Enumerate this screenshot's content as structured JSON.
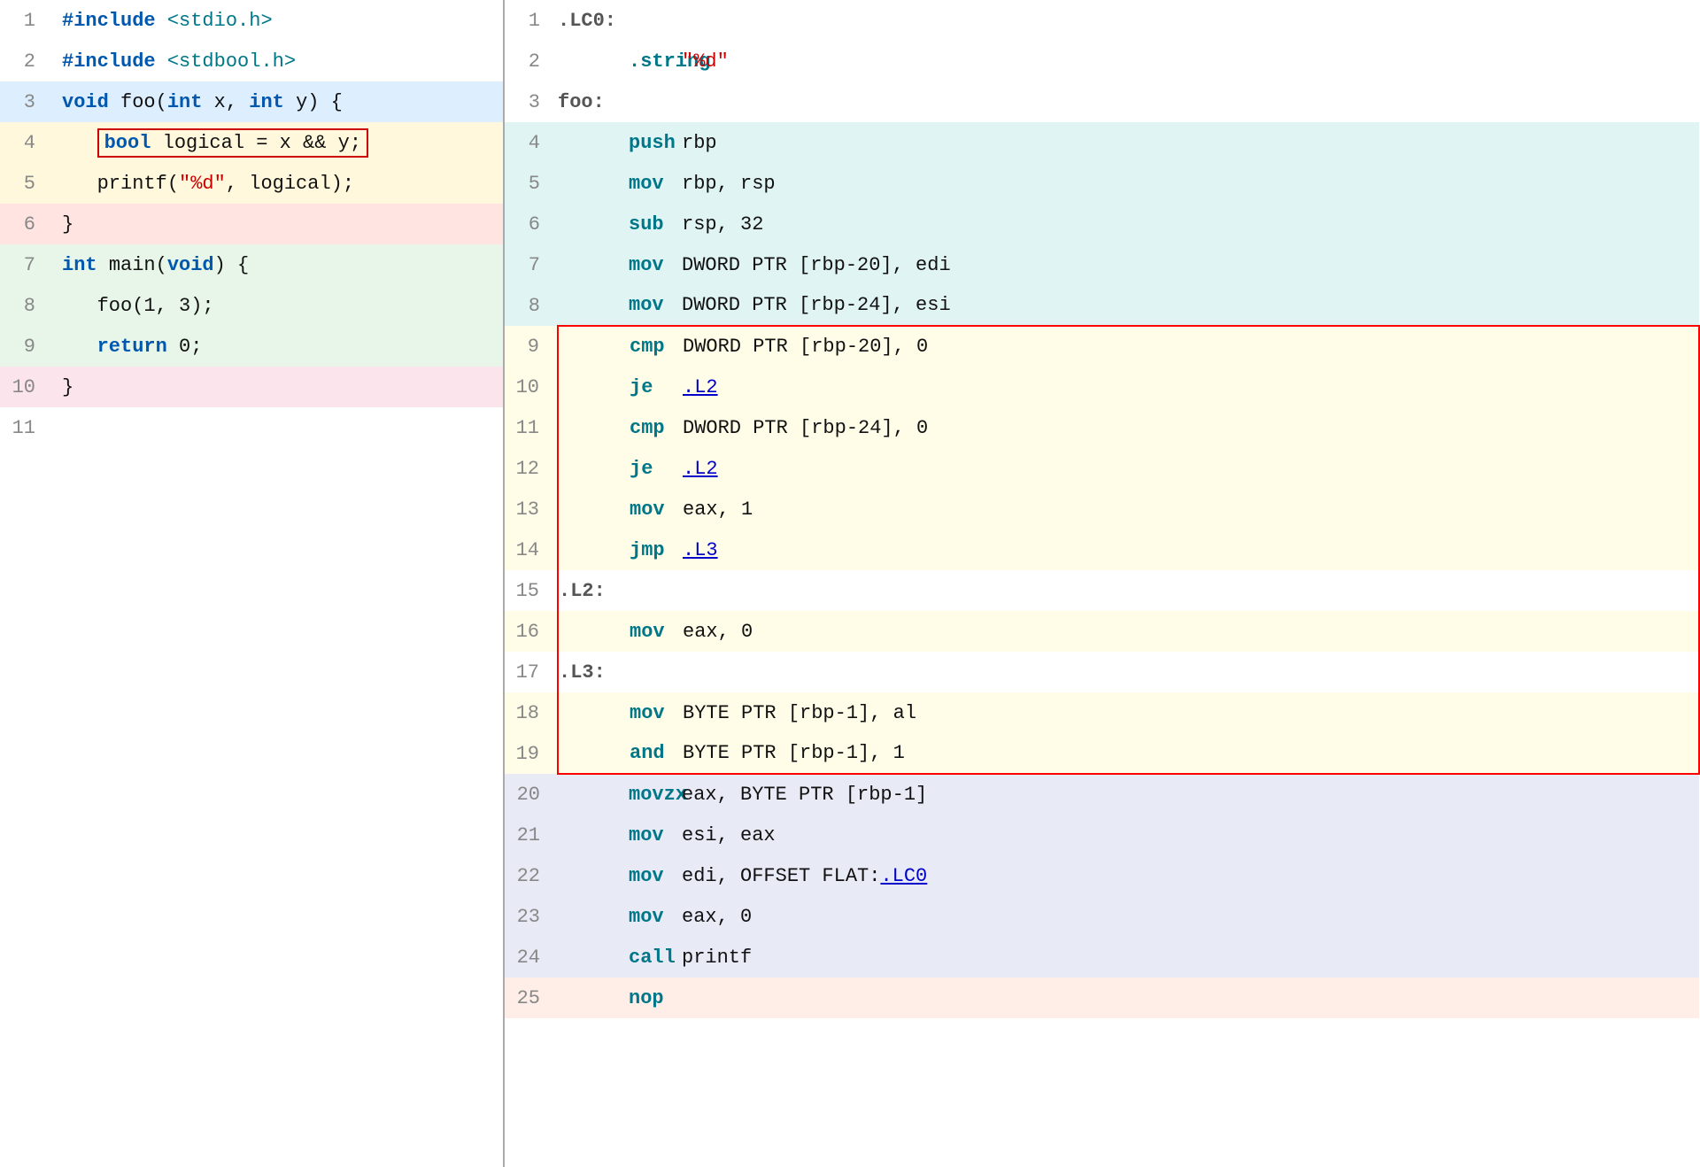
{
  "left": {
    "lines": [
      {
        "num": 1,
        "bg": "bg-white",
        "tokens": [
          {
            "text": "#include ",
            "cls": "c-blue bold"
          },
          {
            "text": "<stdio.h>",
            "cls": "c-teal"
          }
        ]
      },
      {
        "num": 2,
        "bg": "bg-white",
        "tokens": [
          {
            "text": "#include ",
            "cls": "c-blue bold"
          },
          {
            "text": "<stdbool.h>",
            "cls": "c-teal"
          }
        ]
      },
      {
        "num": 3,
        "bg": "bg-blue-light",
        "tokens": [
          {
            "text": "void ",
            "cls": "c-blue bold"
          },
          {
            "text": "foo(",
            "cls": "c-black"
          },
          {
            "text": "int ",
            "cls": "c-blue bold"
          },
          {
            "text": "x, ",
            "cls": "c-black"
          },
          {
            "text": "int ",
            "cls": "c-blue bold"
          },
          {
            "text": "y) {",
            "cls": "c-black"
          }
        ]
      },
      {
        "num": 4,
        "bg": "bg-yellow-light",
        "outline": true,
        "tokens": [
          {
            "text": "bool ",
            "cls": "c-blue bold"
          },
          {
            "text": "logical = x && y;",
            "cls": "c-black"
          }
        ]
      },
      {
        "num": 5,
        "bg": "bg-yellow-light",
        "tokens": [
          {
            "text": "printf(",
            "cls": "c-black"
          },
          {
            "text": "\"%d\"",
            "cls": "c-red"
          },
          {
            "text": ", logical);",
            "cls": "c-black"
          }
        ]
      },
      {
        "num": 6,
        "bg": "bg-red-light",
        "tokens": [
          {
            "text": "}",
            "cls": "c-black"
          }
        ]
      },
      {
        "num": 7,
        "bg": "bg-green-light",
        "tokens": [
          {
            "text": "int ",
            "cls": "c-blue bold"
          },
          {
            "text": "main(",
            "cls": "c-black"
          },
          {
            "text": "void",
            "cls": "c-blue bold"
          },
          {
            "text": ") {",
            "cls": "c-black"
          }
        ]
      },
      {
        "num": 8,
        "bg": "bg-green-light",
        "tokens": [
          {
            "text": "foo(1, 3);",
            "cls": "c-black"
          }
        ]
      },
      {
        "num": 9,
        "bg": "bg-green-light",
        "tokens": [
          {
            "text": "return ",
            "cls": "c-blue bold"
          },
          {
            "text": "0;",
            "cls": "c-black"
          }
        ]
      },
      {
        "num": 10,
        "bg": "bg-pink-light",
        "tokens": [
          {
            "text": "}",
            "cls": "c-black"
          }
        ]
      },
      {
        "num": 11,
        "bg": "bg-white",
        "tokens": []
      }
    ]
  },
  "right": {
    "lines": [
      {
        "num": 1,
        "bg": "bg-white-asm",
        "label": ".LC0:",
        "mnemonic": "",
        "operands": ""
      },
      {
        "num": 2,
        "bg": "bg-white-asm",
        "label": "",
        "mnemonic": ".string",
        "operands": "\"%d\"",
        "operands_cls": "c-red"
      },
      {
        "num": 3,
        "bg": "bg-white-asm",
        "label": "foo:",
        "mnemonic": "",
        "operands": ""
      },
      {
        "num": 4,
        "bg": "bg-teal-light",
        "label": "",
        "mnemonic": "push",
        "operands": "rbp"
      },
      {
        "num": 5,
        "bg": "bg-teal-light",
        "label": "",
        "mnemonic": "mov",
        "operands": "rbp, rsp"
      },
      {
        "num": 6,
        "bg": "bg-teal-light",
        "label": "",
        "mnemonic": "sub",
        "operands": "rsp, 32"
      },
      {
        "num": 7,
        "bg": "bg-teal-light",
        "label": "",
        "mnemonic": "mov",
        "operands": "DWORD PTR [rbp-20], edi"
      },
      {
        "num": 8,
        "bg": "bg-teal-light",
        "label": "",
        "mnemonic": "mov",
        "operands": "DWORD PTR [rbp-24], esi"
      },
      {
        "num": 9,
        "bg": "bg-yellow-asm",
        "label": "",
        "mnemonic": "cmp",
        "operands": "DWORD PTR [rbp-20], 0",
        "hl_top": true,
        "hl_left": true,
        "hl_right": true
      },
      {
        "num": 10,
        "bg": "bg-yellow-asm",
        "label": "",
        "mnemonic": "je",
        "operands": ".L2",
        "operands_cls": "c-link",
        "hl_left": true,
        "hl_right": true
      },
      {
        "num": 11,
        "bg": "bg-yellow-asm",
        "label": "",
        "mnemonic": "cmp",
        "operands": "DWORD PTR [rbp-24], 0",
        "hl_left": true,
        "hl_right": true
      },
      {
        "num": 12,
        "bg": "bg-yellow-asm",
        "label": "",
        "mnemonic": "je",
        "operands": ".L2",
        "operands_cls": "c-link",
        "hl_left": true,
        "hl_right": true
      },
      {
        "num": 13,
        "bg": "bg-yellow-asm",
        "label": "",
        "mnemonic": "mov",
        "operands": "eax, 1",
        "hl_left": true,
        "hl_right": true
      },
      {
        "num": 14,
        "bg": "bg-yellow-asm",
        "label": "",
        "mnemonic": "jmp",
        "operands": ".L3",
        "operands_cls": "c-link",
        "hl_left": true,
        "hl_right": true
      },
      {
        "num": 15,
        "bg": "bg-white-asm",
        "label": ".L2:",
        "mnemonic": "",
        "operands": "",
        "hl_left": true,
        "hl_right": true
      },
      {
        "num": 16,
        "bg": "bg-yellow-asm",
        "label": "",
        "mnemonic": "mov",
        "operands": "eax, 0",
        "hl_left": true,
        "hl_right": true
      },
      {
        "num": 17,
        "bg": "bg-white-asm",
        "label": ".L3:",
        "mnemonic": "",
        "operands": "",
        "hl_left": true,
        "hl_right": true
      },
      {
        "num": 18,
        "bg": "bg-yellow-asm",
        "label": "",
        "mnemonic": "mov",
        "operands": "BYTE PTR [rbp-1], al",
        "hl_left": true,
        "hl_right": true
      },
      {
        "num": 19,
        "bg": "bg-yellow-asm",
        "label": "",
        "mnemonic": "and",
        "operands": "BYTE PTR [rbp-1], 1",
        "hl_left": true,
        "hl_right": true,
        "hl_bottom": true
      },
      {
        "num": 20,
        "bg": "bg-blue-asm",
        "label": "",
        "mnemonic": "movzx",
        "operands": "eax, BYTE PTR [rbp-1]"
      },
      {
        "num": 21,
        "bg": "bg-blue-asm",
        "label": "",
        "mnemonic": "mov",
        "operands": "esi, eax"
      },
      {
        "num": 22,
        "bg": "bg-blue-asm",
        "label": "",
        "mnemonic": "mov",
        "operands": "edi, OFFSET FLAT:.LC0",
        "operands_link": ".LC0"
      },
      {
        "num": 23,
        "bg": "bg-blue-asm",
        "label": "",
        "mnemonic": "mov",
        "operands": "eax, 0"
      },
      {
        "num": 24,
        "bg": "bg-blue-asm",
        "label": "",
        "mnemonic": "call",
        "operands": "printf"
      },
      {
        "num": 25,
        "bg": "bg-salmon",
        "label": "",
        "mnemonic": "nop",
        "operands": ""
      }
    ]
  }
}
